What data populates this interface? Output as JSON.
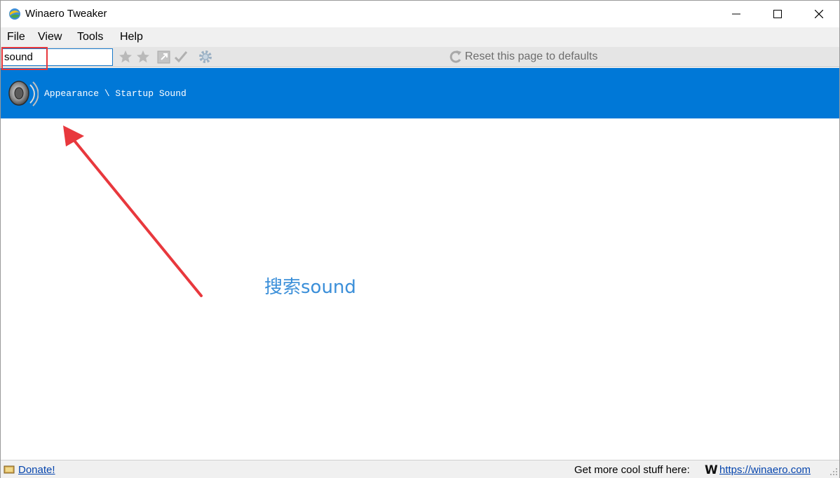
{
  "window": {
    "title": "Winaero Tweaker",
    "icons": {
      "app": "winaero-globe-icon",
      "minimize": "minimize-icon",
      "maximize": "maximize-icon",
      "close": "close-icon"
    }
  },
  "menu": {
    "items": [
      {
        "label": "File"
      },
      {
        "label": "View"
      },
      {
        "label": "Tools"
      },
      {
        "label": "Help"
      }
    ]
  },
  "toolbar": {
    "search_value": "sound",
    "reset_label": "Reset this page to defaults",
    "icons": [
      "star-add-icon",
      "star-icon",
      "open-link-icon",
      "checkmark-icon",
      "gear-icon",
      "reset-icon"
    ]
  },
  "results": [
    {
      "path": "Appearance \\ Startup Sound",
      "icon": "speaker-icon"
    }
  ],
  "annotation": {
    "label": "搜索sound",
    "color": "#e8383d"
  },
  "status": {
    "donate_label": "Donate!",
    "more_text": "Get more cool stuff here:",
    "logo": "W",
    "site_link": "https://winaero.com"
  },
  "colors": {
    "accent": "#0078d7",
    "annotation_red": "#e8383d",
    "annotation_text": "#3b8fd9",
    "link": "#0645ad"
  }
}
